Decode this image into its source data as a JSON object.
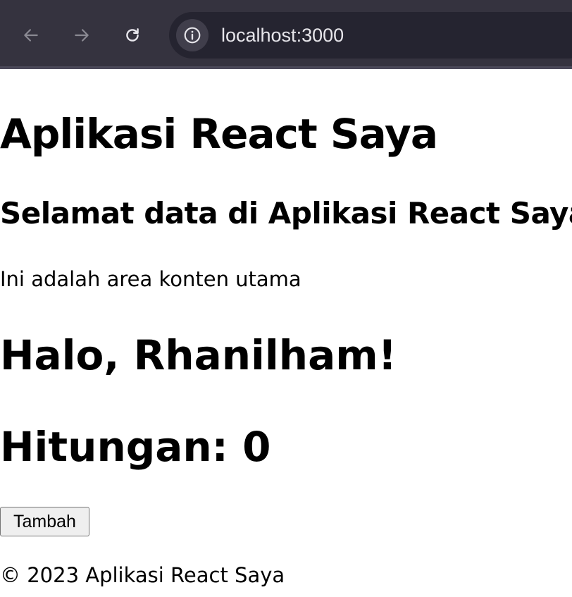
{
  "browser": {
    "url": "localhost:3000",
    "icons": [
      "back-arrow-icon",
      "forward-arrow-icon",
      "reload-icon",
      "info-icon"
    ]
  },
  "page": {
    "title": "Aplikasi React Saya",
    "welcome": "Selamat data di Aplikasi React Saya",
    "content_text": "Ini adalah area konten utama",
    "greeting": "Halo, Rhanilham!",
    "counter": "Hitungan: 0",
    "add_button_label": "Tambah",
    "footer": "© 2023 Aplikasi React Saya"
  }
}
